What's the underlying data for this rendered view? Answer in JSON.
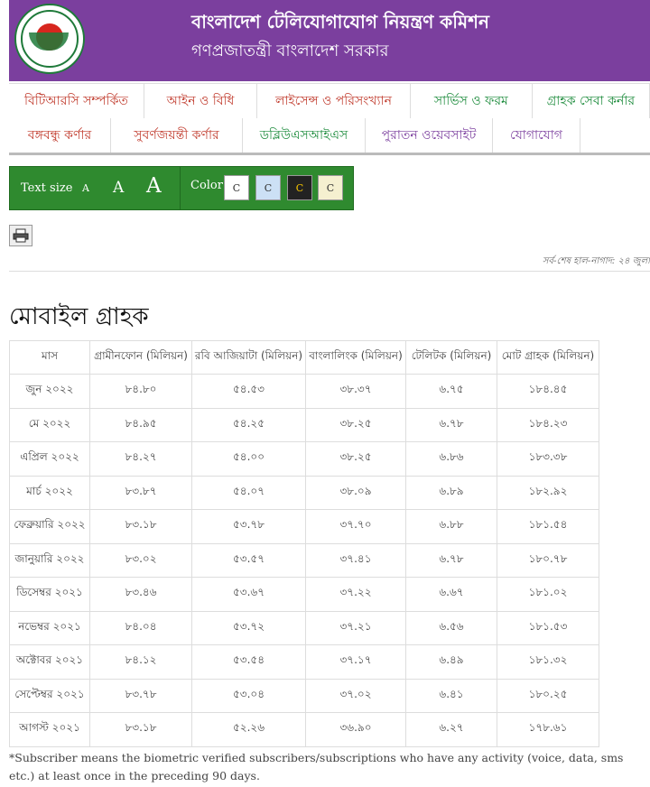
{
  "header": {
    "title": "বাংলাদেশ টেলিযোগাযোগ নিয়ন্ত্রণ কমিশন",
    "subtitle": "গণপ্রজাতন্ত্রী বাংলাদেশ সরকার",
    "logo_text": "গণপ্রজাতন্ত্রী বাংলাদেশ সরকার"
  },
  "nav_primary": [
    "বিটিআরসি সম্পর্কিত",
    "আইন ও বিধি",
    "লাইসেন্স ও পরিসংখ্যান",
    "সার্ভিস ও ফরম",
    "গ্রাহক সেবা কর্নার"
  ],
  "nav_secondary": [
    "বঙ্গবন্ধু কর্ণার",
    "সুবর্ণজয়ন্তী কর্ণার",
    "ডব্লিউএসআইএস",
    "পুরাতন ওয়েবসাইট",
    "যোগাযোগ"
  ],
  "toolbar": {
    "text_size_label": "Text size",
    "size_small": "A",
    "size_medium": "A",
    "size_large": "A",
    "color_label": "Color",
    "swatches": [
      {
        "label": "C",
        "bg": "#ffffff",
        "fg": "#333333"
      },
      {
        "label": "C",
        "bg": "#cce0f5",
        "fg": "#333333"
      },
      {
        "label": "C",
        "bg": "#222222",
        "fg": "#f5c400"
      },
      {
        "label": "C",
        "bg": "#f5f0d0",
        "fg": "#333333"
      }
    ]
  },
  "last_updated": "সর্ব-শেষ হাল-নাগাদ: ২৪ জুলা",
  "page_title": "মোবাইল গ্রাহক",
  "table": {
    "headers": [
      "মাস",
      "গ্রামীনফোন (মিলিয়ন)",
      "রবি আজিয়াটা (মিলিয়ন)",
      "বাংলালিংক (মিলিয়ন)",
      "টেলিটক (মিলিয়ন)",
      "মোট গ্রাহক (মিলিয়ন)"
    ],
    "rows": [
      [
        "জুন ২০২২",
        "৮৪.৮০",
        "৫৪.৫৩",
        "৩৮.৩৭",
        "৬.৭৫",
        "১৮৪.৪৫"
      ],
      [
        "মে ২০২২",
        "৮৪.৯৫",
        "৫৪.২৫",
        "৩৮.২৫",
        "৬.৭৮",
        "১৮৪.২৩"
      ],
      [
        "এপ্রিল ২০২২",
        "৮৪.২৭",
        "৫৪.০০",
        "৩৮.২৫",
        "৬.৮৬",
        "১৮৩.৩৮"
      ],
      [
        "মার্চ ২০২২",
        "৮৩.৮৭",
        "৫৪.০৭",
        "৩৮.০৯",
        "৬.৮৯",
        "১৮২.৯২"
      ],
      [
        "ফেব্রুয়ারি ২০২২",
        "৮৩.১৮",
        "৫৩.৭৮",
        "৩৭.৭০",
        "৬.৮৮",
        "১৮১.৫৪"
      ],
      [
        "জানুয়ারি ২০২২",
        "৮৩.০২",
        "৫৩.৫৭",
        "৩৭.৪১",
        "৬.৭৮",
        "১৮০.৭৮"
      ],
      [
        "ডিসেম্বর ২০২১",
        "৮৩.৪৬",
        "৫৩.৬৭",
        "৩৭.২২",
        "৬.৬৭",
        "১৮১.০২"
      ],
      [
        "নভেম্বর ২০২১",
        "৮৪.০৪",
        "৫৩.৭২",
        "৩৭.২১",
        "৬.৫৬",
        "১৮১.৫৩"
      ],
      [
        "অক্টোবর ২০২১",
        "৮৪.১২",
        "৫৩.৫৪",
        "৩৭.১৭",
        "৬.৪৯",
        "১৮১.৩২"
      ],
      [
        "সেপ্টেম্বর ২০২১",
        "৮৩.৭৮",
        "৫৩.০৪",
        "৩৭.০২",
        "৬.৪১",
        "১৮০.২৫"
      ],
      [
        "আগস্ট ২০২১",
        "৮৩.১৮",
        "৫২.২৬",
        "৩৬.৯০",
        "৬.২৭",
        "১৭৮.৬১"
      ]
    ]
  },
  "footnote": "*Subscriber means the biometric verified subscribers/subscriptions who have any activity (voice, data, sms etc.) at least once in the preceding 90 days."
}
